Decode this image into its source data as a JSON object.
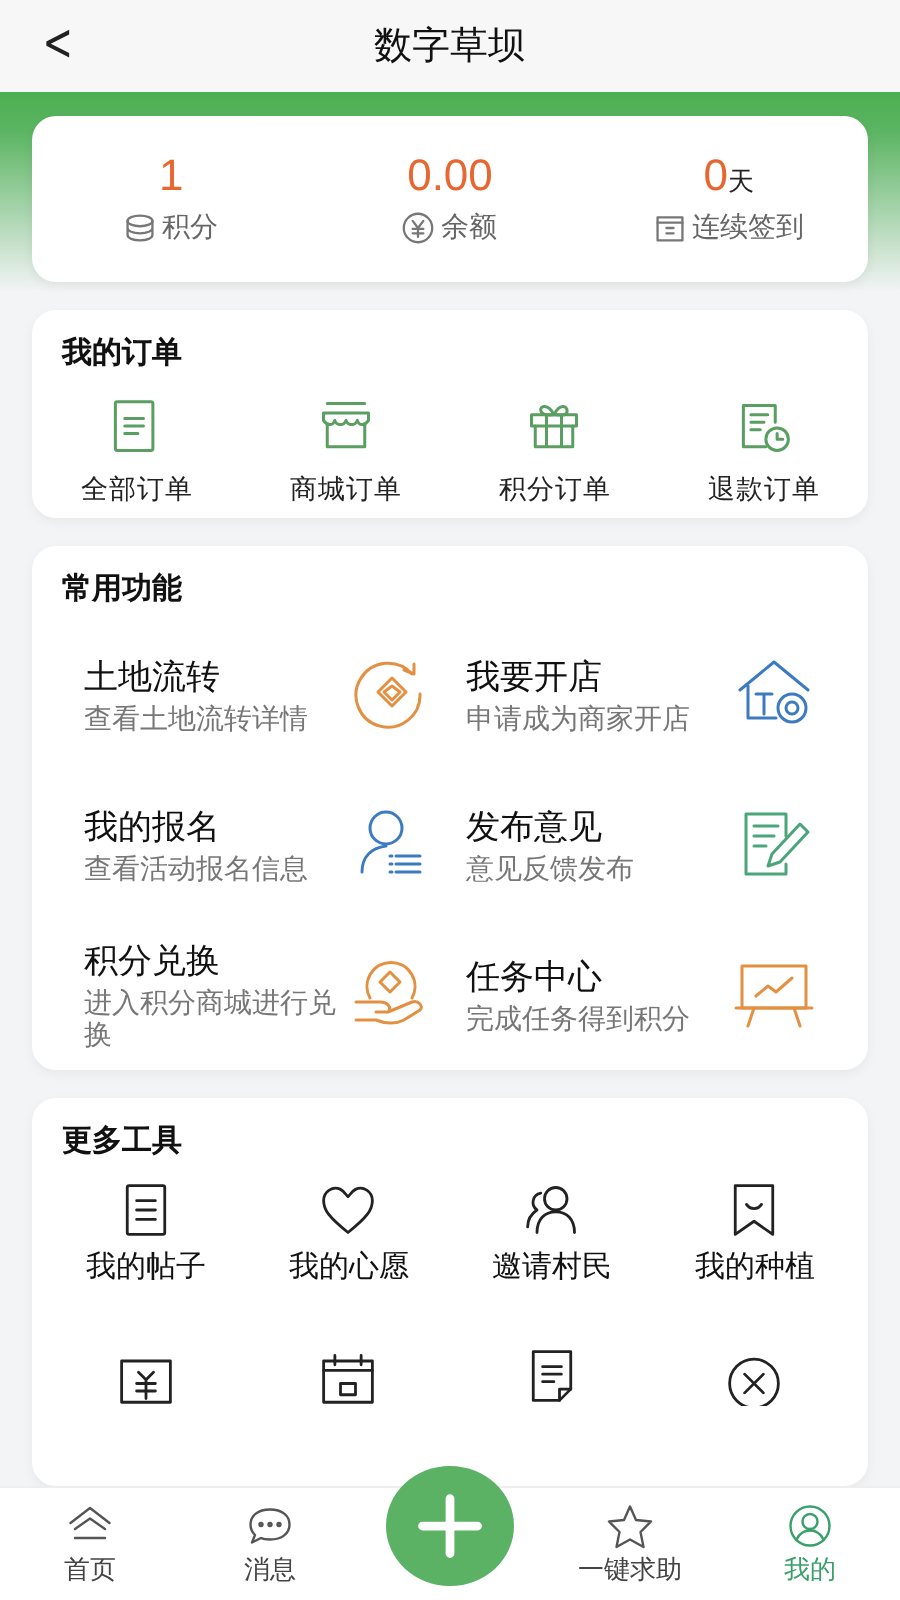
{
  "header": {
    "back": "<",
    "title": "数字草坝"
  },
  "stats": [
    {
      "value": "1",
      "label": "积分",
      "kind": "coins"
    },
    {
      "value": "0.00",
      "label": "余额",
      "kind": "yuan"
    },
    {
      "value": "0",
      "unit": "天",
      "label": "连续签到",
      "kind": "calendar"
    }
  ],
  "orders": {
    "title": "我的订单",
    "items": [
      {
        "label": "全部订单",
        "kind": "doc"
      },
      {
        "label": "商城订单",
        "kind": "shop"
      },
      {
        "label": "积分订单",
        "kind": "gift"
      },
      {
        "label": "退款订单",
        "kind": "refund"
      }
    ]
  },
  "functions": {
    "title": "常用功能",
    "items": [
      {
        "title": "土地流转",
        "subtitle": "查看土地流转详情",
        "kind": "land"
      },
      {
        "title": "我要开店",
        "subtitle": "申请成为商家开店",
        "kind": "store"
      },
      {
        "title": "我的报名",
        "subtitle": "查看活动报名信息",
        "kind": "person"
      },
      {
        "title": "发布意见",
        "subtitle": "意见反馈发布",
        "kind": "edit"
      },
      {
        "title": "积分兑换",
        "subtitle": "进入积分商城进行兑换",
        "kind": "exchange"
      },
      {
        "title": "任务中心",
        "subtitle": "完成任务得到积分",
        "kind": "board"
      }
    ]
  },
  "more_tools": {
    "title": "更多工具",
    "items": [
      {
        "label": "我的帖子",
        "kind": "post"
      },
      {
        "label": "我的心愿",
        "kind": "heart"
      },
      {
        "label": "邀请村民",
        "kind": "people"
      },
      {
        "label": "我的种植",
        "kind": "bookmark"
      },
      {
        "kind": "money"
      },
      {
        "kind": "date"
      },
      {
        "kind": "note"
      },
      {
        "kind": "cancel"
      }
    ]
  },
  "tab_bar": [
    {
      "label": "首页",
      "kind": "home",
      "selected": false
    },
    {
      "label": "消息",
      "kind": "chat",
      "selected": false
    },
    {
      "kind": "plus",
      "selected": false
    },
    {
      "label": "一键求助",
      "kind": "star",
      "selected": false
    },
    {
      "label": "我的",
      "kind": "user",
      "selected": true
    }
  ]
}
